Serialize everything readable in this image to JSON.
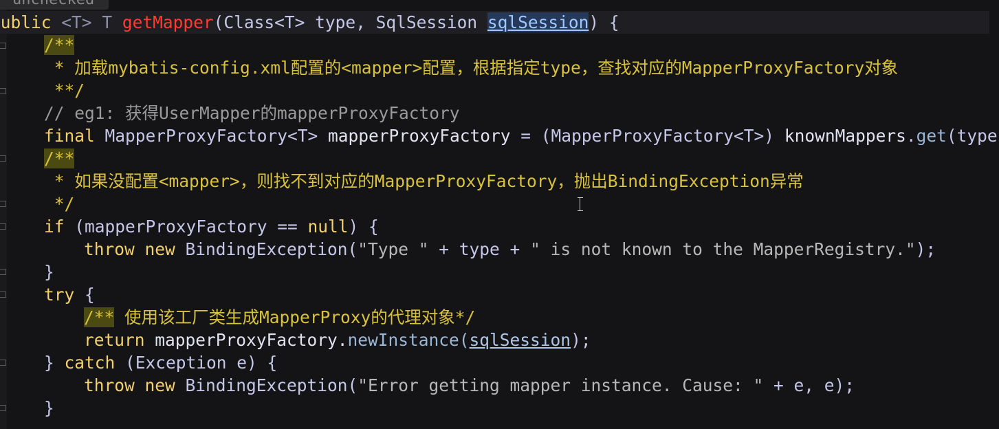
{
  "editor": {
    "hint_label": "unchecked\"",
    "lines": [
      {
        "t1": "public",
        "t2": "<T>",
        "t3": "T",
        "t4": "getMapper",
        "t5": "(Class<T> type, SqlSession ",
        "t6": "sqlSession",
        "t7": ") {"
      },
      {
        "t1": "/**"
      },
      {
        "t1": " * 加载mybatis-config.xml配置的<mapper>配置，根据指定type，查找对应的MapperProxyFactory对象"
      },
      {
        "t1": " **/"
      },
      {
        "t1": "// eg1: 获得UserMapper的mapperProxyFactory"
      },
      {
        "t1": "final",
        "t2": " MapperProxyFactory<T> ",
        "t3": "mapperProxyFactory",
        "t4": " = (MapperProxyFactory<T>) ",
        "t5": "knownMappers",
        "t6": ".",
        "t7": "get",
        "t8": "(type);"
      },
      {
        "t1": "/**"
      },
      {
        "t1": " * 如果没配置<mapper>，则找不到对应的MapperProxyFactory，抛出BindingException异常"
      },
      {
        "t1": " */"
      },
      {
        "t1": "if",
        "t2": " (mapperProxyFactory == ",
        "t3": "null",
        "t4": ") {"
      },
      {
        "t1": "throw new",
        "t2": " BindingException(",
        "t3": "\"Type \"",
        "t4": " + type + ",
        "t5": "\" is not known to the MapperRegistry.\"",
        "t6": ");"
      },
      {
        "t1": "}"
      },
      {
        "t1": "try",
        "t2": " {"
      },
      {
        "t1": "/**",
        "t2": " 使用该工厂类生成MapperProxy的代理对象*/"
      },
      {
        "t1": "return",
        "t2": " mapperProxyFactory.",
        "t3": "newInstance(",
        "t4": "sqlSession",
        "t5": ");"
      },
      {
        "t1": "} ",
        "t2": "catch",
        "t3": " (Exception e) {"
      },
      {
        "t1": "throw new",
        "t2": " BindingException(",
        "t3": "\"Error getting mapper instance. Cause: \"",
        "t4": " + e, e);"
      },
      {
        "t1": "}"
      }
    ]
  }
}
